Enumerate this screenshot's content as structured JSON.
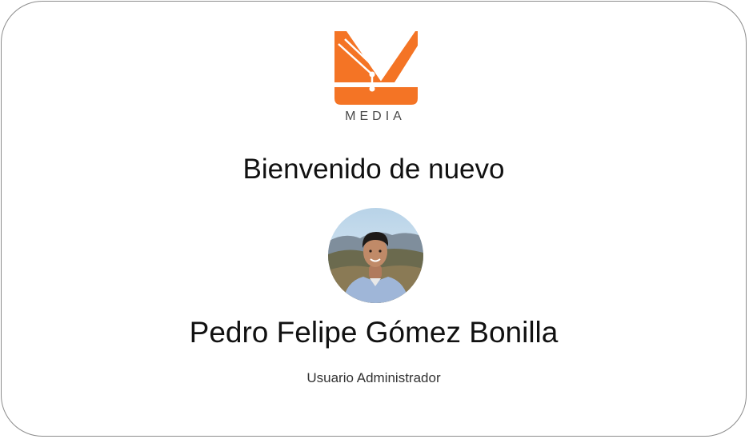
{
  "brand": {
    "logo_text": "MEDIA",
    "accent_color": "#F47425",
    "logo_icon": "lightning-k-icon"
  },
  "welcome": {
    "heading": "Bienvenido de nuevo"
  },
  "user": {
    "name": "Pedro Felipe Gómez Bonilla",
    "role": "Usuario Administrador",
    "avatar_icon": "user-avatar-photo"
  }
}
